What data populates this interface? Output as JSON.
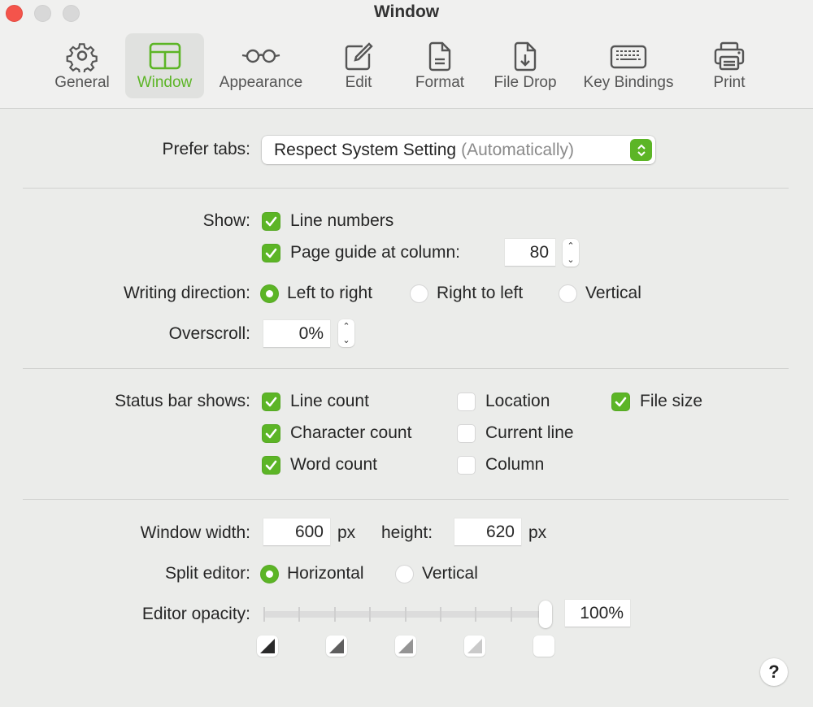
{
  "window": {
    "title": "Window",
    "traffic_lights": [
      "close",
      "minimize",
      "zoom"
    ]
  },
  "toolbar": {
    "accent_color": "#5cb526",
    "items": [
      {
        "label": "General",
        "icon": "gear-icon",
        "active": false
      },
      {
        "label": "Window",
        "icon": "window-layout-icon",
        "active": true
      },
      {
        "label": "Appearance",
        "icon": "glasses-icon",
        "active": false
      },
      {
        "label": "Edit",
        "icon": "edit-icon",
        "active": false
      },
      {
        "label": "Format",
        "icon": "document-icon",
        "active": false
      },
      {
        "label": "File Drop",
        "icon": "file-download-icon",
        "active": false
      },
      {
        "label": "Key Bindings",
        "icon": "keyboard-icon",
        "active": false
      },
      {
        "label": "Print",
        "icon": "printer-icon",
        "active": false
      }
    ]
  },
  "prefer_tabs": {
    "label": "Prefer tabs:",
    "value": "Respect System Setting",
    "value_suffix": "(Automatically)"
  },
  "show": {
    "label": "Show:",
    "line_numbers": {
      "label": "Line numbers",
      "checked": true
    },
    "page_guide": {
      "label": "Page guide at column:",
      "checked": true,
      "value": "80"
    }
  },
  "writing_direction": {
    "label": "Writing direction:",
    "options": [
      {
        "label": "Left to right",
        "selected": true
      },
      {
        "label": "Right to left",
        "selected": false
      },
      {
        "label": "Vertical",
        "selected": false
      }
    ]
  },
  "overscroll": {
    "label": "Overscroll:",
    "value": "0%"
  },
  "status_bar": {
    "label": "Status bar shows:",
    "items": [
      {
        "label": "Line count",
        "checked": true
      },
      {
        "label": "Character count",
        "checked": true
      },
      {
        "label": "Word count",
        "checked": true
      },
      {
        "label": "Location",
        "checked": false
      },
      {
        "label": "Current line",
        "checked": false
      },
      {
        "label": "Column",
        "checked": false
      },
      {
        "label": "File size",
        "checked": true
      }
    ]
  },
  "window_size": {
    "width_label": "Window width:",
    "width_value": "600",
    "width_unit": "px",
    "height_label": "height:",
    "height_value": "620",
    "height_unit": "px"
  },
  "split_editor": {
    "label": "Split editor:",
    "options": [
      {
        "label": "Horizontal",
        "selected": true
      },
      {
        "label": "Vertical",
        "selected": false
      }
    ]
  },
  "editor_opacity": {
    "label": "Editor opacity:",
    "value_text": "100%",
    "slider_fraction": 1.0,
    "tick_count": 9,
    "swatch_colors": [
      "#2a2a2a",
      "#5e5e5e",
      "#949494",
      "#cacaca",
      "#ffffff"
    ]
  },
  "help": {
    "label": "?"
  }
}
